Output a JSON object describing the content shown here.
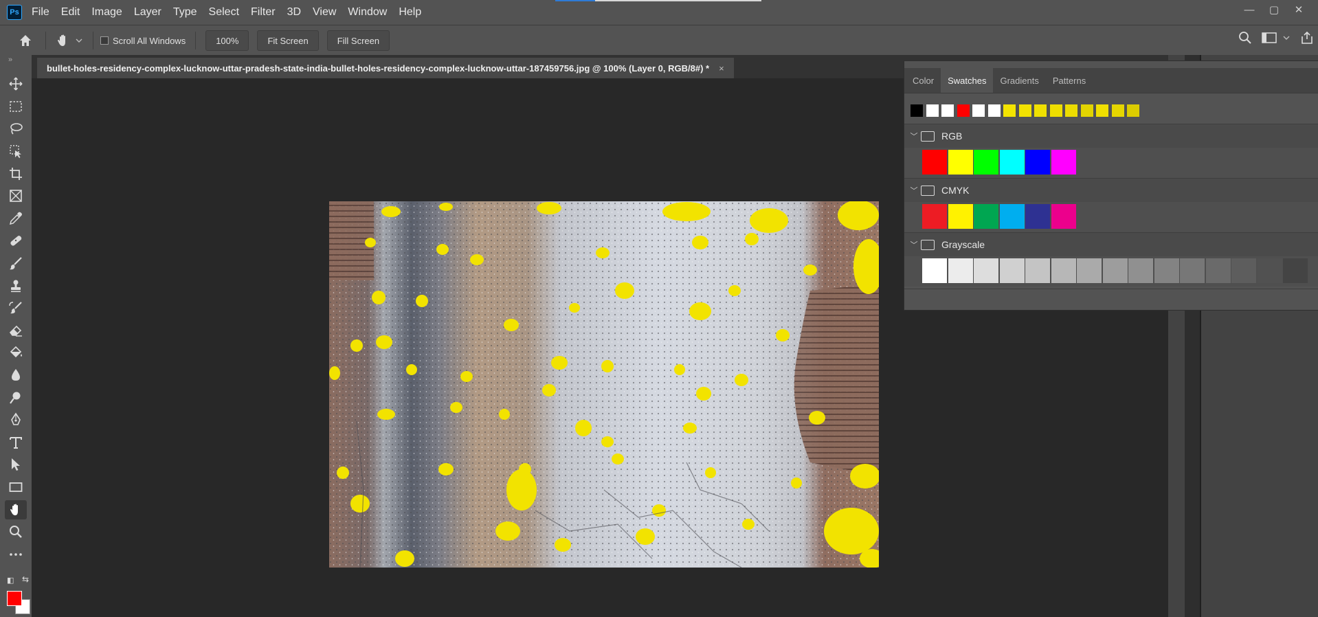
{
  "app": {
    "logo_text": "Ps"
  },
  "menubar": {
    "items": [
      "File",
      "Edit",
      "Image",
      "Layer",
      "Type",
      "Select",
      "Filter",
      "3D",
      "View",
      "Window",
      "Help"
    ]
  },
  "window_controls": {
    "minimize": "—",
    "maximize": "▢",
    "close": "✕"
  },
  "options_bar": {
    "scroll_all_windows_label": "Scroll All Windows",
    "zoom_value": "100%",
    "fit_screen_label": "Fit Screen",
    "fill_screen_label": "Fill Screen"
  },
  "document": {
    "tab_title": "bullet-holes-residency-complex-lucknow-uttar-pradesh-state-india-bullet-holes-residency-complex-lucknow-uttar-187459756.jpg @ 100% (Layer 0, RGB/8#) *",
    "close_glyph": "×"
  },
  "toolbar": {
    "collapse_glyph": "»",
    "tools": [
      "move-tool",
      "rectangular-marquee-tool",
      "lasso-tool",
      "object-selection-tool",
      "crop-tool",
      "frame-tool",
      "eyedropper-tool",
      "spot-healing-tool",
      "brush-tool",
      "clone-stamp-tool",
      "history-brush-tool",
      "eraser-tool",
      "paint-bucket-tool",
      "blur-tool",
      "dodge-tool",
      "pen-tool",
      "type-tool",
      "path-selection-tool",
      "rectangle-tool",
      "hand-tool",
      "zoom-tool",
      "more-tools"
    ],
    "active_tool": "hand-tool",
    "foreground_color": "#ff0000",
    "background_color": "#ffffff"
  },
  "swatches_panel": {
    "tabs": [
      "Color",
      "Swatches",
      "Gradients",
      "Patterns"
    ],
    "active_tab": "Swatches",
    "recent_colors": [
      "#000000",
      "#ffffff",
      "#ffffff",
      "#ff0000",
      "#ffffff",
      "#ffffff",
      "#f4e400",
      "#f2e200",
      "#f0e000",
      "#eede00",
      "#ecdc00",
      "#e2d400",
      "#f0df00",
      "#e6d600",
      "#dccc00"
    ],
    "groups": [
      {
        "name": "RGB",
        "colors": [
          "#ff0000",
          "#ffff00",
          "#00ff00",
          "#00ffff",
          "#0000ff",
          "#ff00ff"
        ]
      },
      {
        "name": "CMYK",
        "colors": [
          "#ed1c24",
          "#fff200",
          "#00a651",
          "#00aeef",
          "#2e3192",
          "#ec008c"
        ]
      },
      {
        "name": "Grayscale",
        "colors": [
          "#ffffff",
          "#ececec",
          "#dddddd",
          "#d0d0d0",
          "#c4c4c4",
          "#b7b7b7",
          "#aaaaaa",
          "#9d9d9d",
          "#909090",
          "#838383",
          "#777777",
          "#6a6a6a",
          "#5d5d5d",
          "#515151",
          "#444444"
        ]
      }
    ]
  }
}
